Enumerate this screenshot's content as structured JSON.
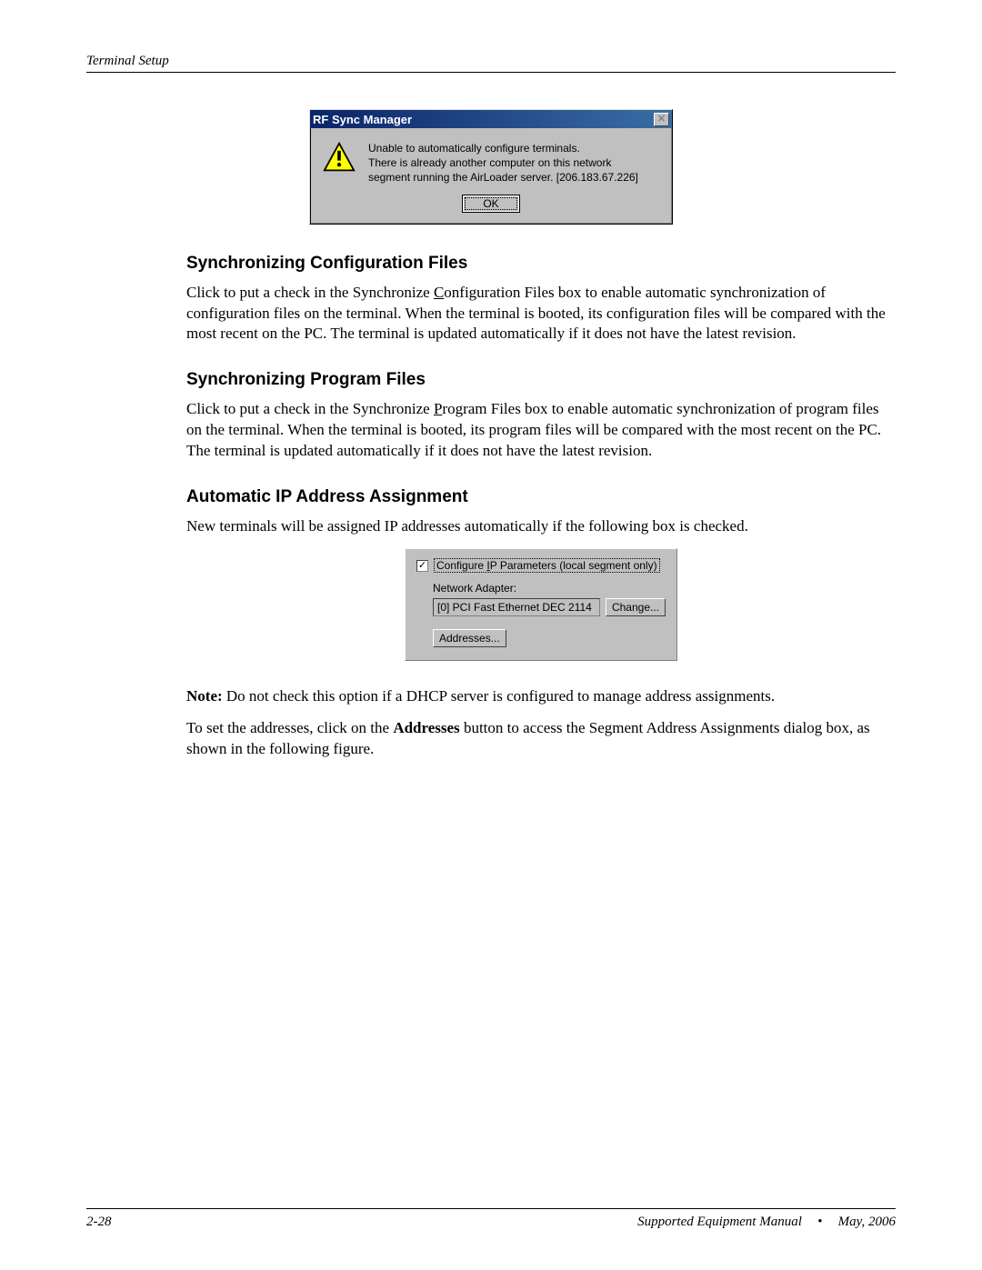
{
  "header": {
    "section_title": "Terminal Setup"
  },
  "dialog1": {
    "title": "RF Sync Manager",
    "line1": "Unable to automatically configure terminals.",
    "line2": "There is already another computer on this network",
    "line3": "segment running the AirLoader server. [206.183.67.226]",
    "ok_label": "OK"
  },
  "sections": {
    "sync_config": {
      "heading": "Synchronizing Configuration Files",
      "p_pre": "Click to put a check in the Synchronize ",
      "p_u": "C",
      "p_post": "onfiguration Files box to enable automatic synchronization of configuration files on the terminal. When the terminal is booted, its configuration files will be compared with the most recent on the PC. The terminal is updated automatically if it does not have the latest revision."
    },
    "sync_prog": {
      "heading": "Synchronizing Program Files",
      "p_pre": "Click to put a check in the Synchronize ",
      "p_u": "P",
      "p_post": "rogram Files box to enable automatic synchronization of program files on the terminal. When the terminal is booted, its program files will be compared with the most recent on the PC. The terminal is updated automatically if it does not have the latest revision."
    },
    "auto_ip": {
      "heading": "Automatic IP Address Assignment",
      "para": "New terminals will be assigned IP addresses automatically if the following box is checked."
    }
  },
  "ip_panel": {
    "checkbox_label_pre": "Configure ",
    "checkbox_label_u": "I",
    "checkbox_label_post": "P Parameters (local segment only)",
    "na_label": "Network Adapter:",
    "adapter_value": "[0] PCI Fast Ethernet DEC 2114",
    "change_label": "Change...",
    "addresses_label": "Addresses..."
  },
  "note": {
    "label": "Note:",
    "text": " Do not check this option if a DHCP server is configured to manage address assignments."
  },
  "closing": {
    "pre": "To set the addresses, click on the ",
    "bold": "Addresses",
    "post": " button to access the Segment Address Assignments dialog box, as shown in the following figure."
  },
  "footer": {
    "page_num": "2-28",
    "doc_title": "Supported Equipment Manual",
    "bullet": "•",
    "date": "May, 2006"
  }
}
